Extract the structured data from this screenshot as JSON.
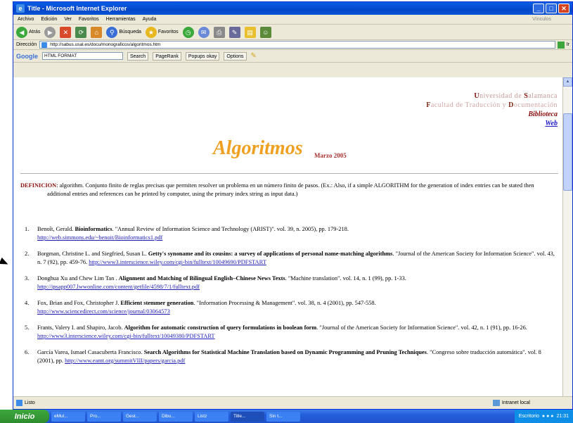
{
  "window": {
    "title": "Title - Microsoft Internet Explorer"
  },
  "menu": {
    "items": [
      "Archivo",
      "Edición",
      "Ver",
      "Favoritos",
      "Herramientas",
      "Ayuda"
    ],
    "right": "Vínculos"
  },
  "toolbar": {
    "back": "Atrás",
    "search": "Búsqueda",
    "favorites": "Favoritos"
  },
  "address": {
    "label": "Dirección",
    "url": "http://sabus.usal.es/docu/monograficos/algoritmos.htm",
    "go": "Ir"
  },
  "google": {
    "brand": "Google",
    "query": "HTML FORMAT",
    "search": "Search",
    "pagerank": "PageRank",
    "popups": "Popups okay",
    "options": "Options"
  },
  "header": {
    "uni_first": "U",
    "uni_rest1": "niversidad de ",
    "uni_s": "S",
    "uni_rest2": "alamanca",
    "fac_f": "F",
    "fac_rest1": "acultad de Traducción y ",
    "fac_d": "D",
    "fac_rest2": "ocumentación",
    "biblioteca": "Biblioteca",
    "web": "Web"
  },
  "title": {
    "main": "Algoritmos",
    "date": "Marzo 2005"
  },
  "definition": {
    "label": "DEFINICION",
    "text": ": algorithm. Conjunto finito de reglas precisas que permiten resolver un problema en un número finito de pasos. (Ex.: Also, if a simple ALGORITHM for the generation of index entries can be stated then additional entries and references can be printed by computer, using the primary index string as input data.)"
  },
  "references": [
    {
      "num": "1.",
      "pre": "Benoît, Gerald. ",
      "bold": "Bioinformatics",
      "post": ". \"Annual Review of Information Science and Technology (ARIST)\". vol. 39, n. 2005), pp. 179-218.",
      "link": "http://web.simmons.edu/~benoit/Bioinformatics1.pdf"
    },
    {
      "num": "2.",
      "pre": "Borgman, Christine L. and Siegfried, Susan L. ",
      "bold": "Getty's synoname and its cousins: a survey of applications of personal name-matching algorithms",
      "post": ". \"Journal of the American Society for Information Science\". vol. 43, n. 7 (92), pp. 459-76. ",
      "link": "http://www3.interscience.wiley.com/cgi-bin/fulltext/10049690/PDFSTART"
    },
    {
      "num": "3.",
      "pre": "Donghua Xu and Chew Lim Tan . ",
      "bold": "Alignment and Matching of Bilingual English–Chinese News Texts",
      "post": ". \"Machine translation\". vol. 14, n. 1 (99), pp. 1-33.",
      "link": "http://ipsapp007.lwwonline.com/content/getfile/4598/7/1/fulltext.pdf"
    },
    {
      "num": "4.",
      "pre": "Fox, Brian and Fox, Christopher J. ",
      "bold": "Efficient stemmer generation",
      "post": ". \"Information Processing & Management\". vol. 38, n. 4 (2001), pp. 547-558.",
      "link": "http://www.sciencedirect.com/science/journal/03064573"
    },
    {
      "num": "5.",
      "pre": "Frants, Valery I. and Shapiro, Jacob. ",
      "bold": "Algorithm for automatic construction of query formulations in boolean form",
      "post": ". \"Journal of the American Society for Information Science\". vol. 42, n. 1 (91), pp. 16-26. ",
      "link": "http://www3.interscience.wiley.com/cgi-bin/fulltext/10049380/PDFSTART"
    },
    {
      "num": "6.",
      "pre": "García Varea, Ismael Casacuberta Francisco. ",
      "bold": "Search Algorithms for Statistical Machine Translation based on Dynamic Programming and Pruning Techniques",
      "post": ". \"Congreso sobre traducción automática\". vol. 8 (2001), pp. ",
      "link": "http://www.eamt.org/summitVIII/papers/garcia.pdf"
    }
  ],
  "status": {
    "left": "Listo",
    "zone": "Intranet local"
  },
  "taskbar": {
    "start": "Inicio",
    "tasks": [
      "eMul...",
      "Pro...",
      "Gest...",
      "Dibu...",
      "Listz",
      "Title...",
      "Sin t..."
    ],
    "tray_label": "Escritorio",
    "clock": "21:31"
  }
}
